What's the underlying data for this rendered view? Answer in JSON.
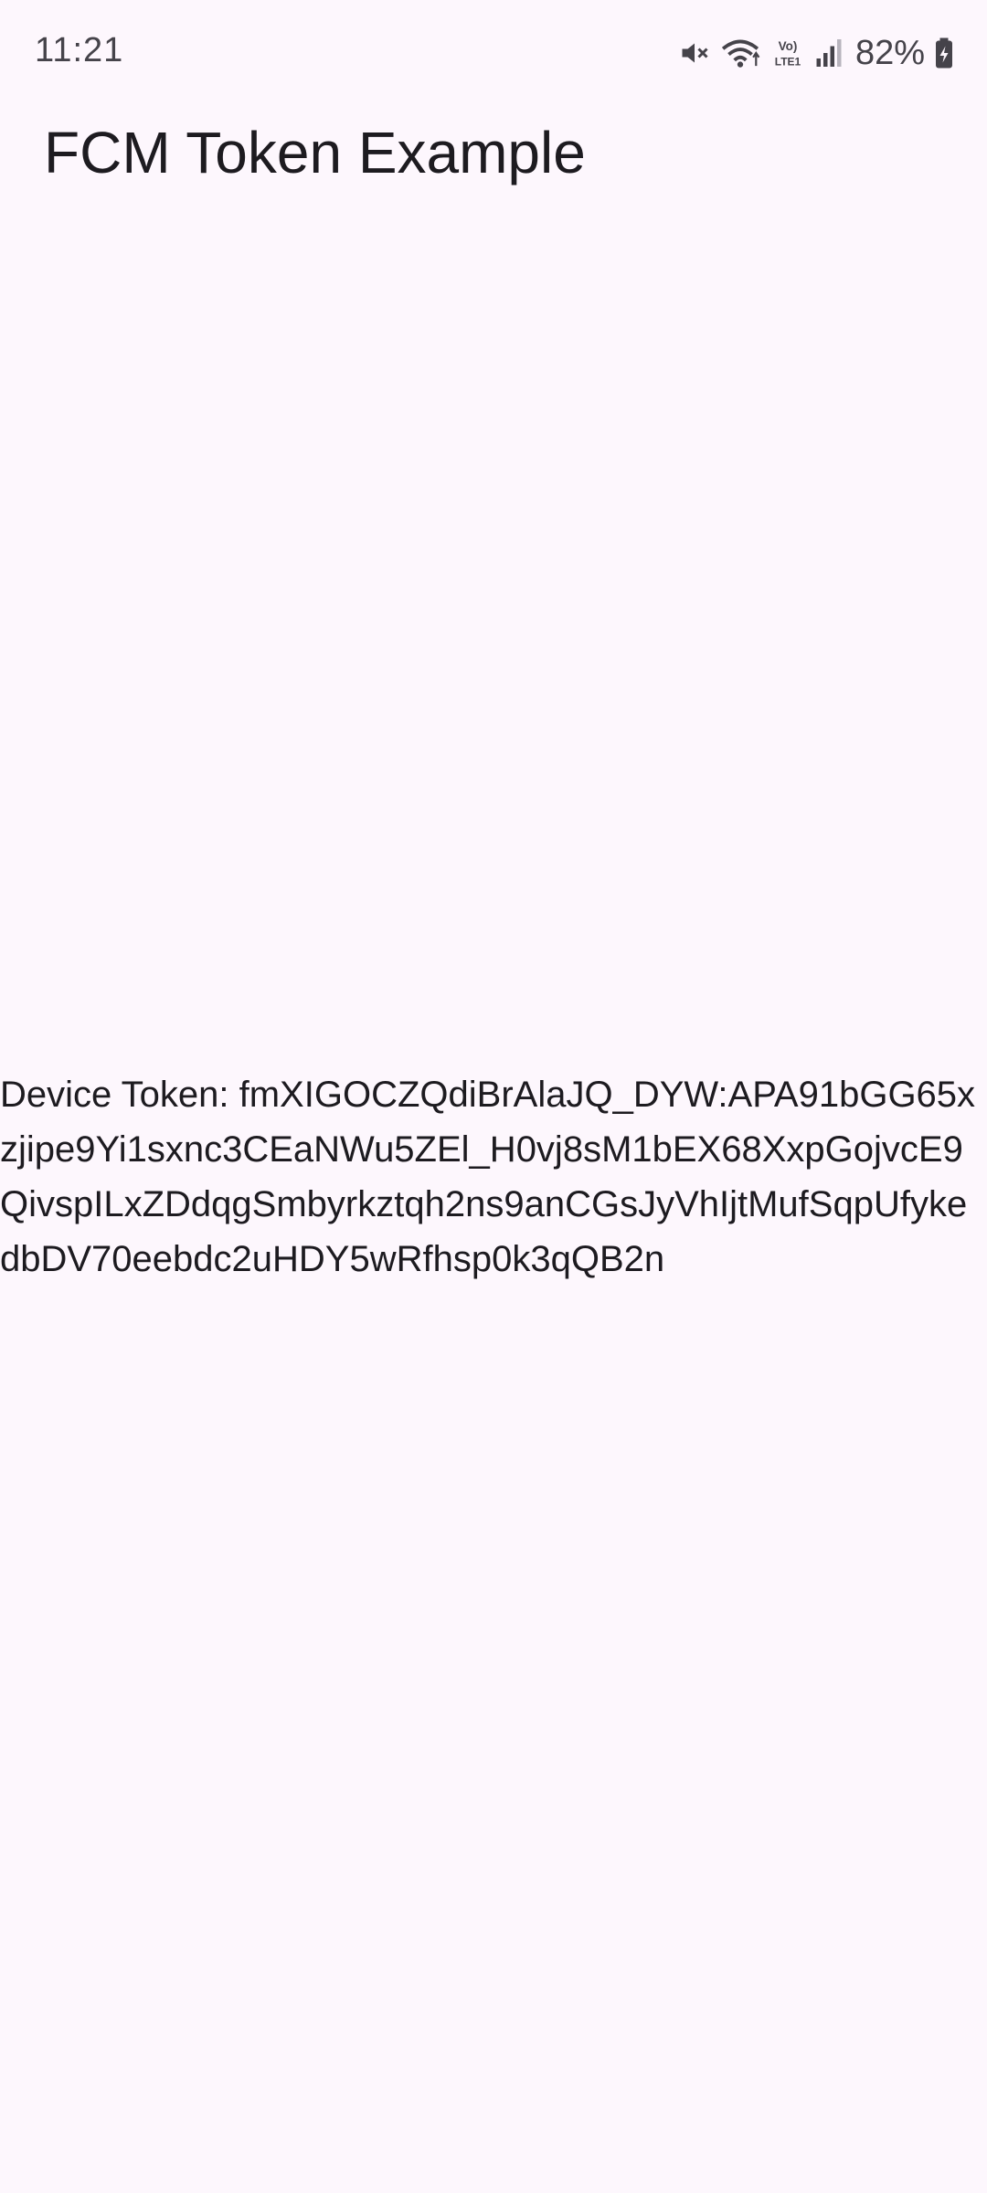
{
  "status_bar": {
    "time": "11:21",
    "battery_percent": "82%",
    "icons": [
      "mute-icon",
      "wifi-icon",
      "volte-icon",
      "signal-icon",
      "battery-icon"
    ],
    "network_label": "VoLTE1"
  },
  "app_bar": {
    "title": "FCM Token Example"
  },
  "main": {
    "token_text": "Device Token: fmXIGOCZQdiBrAlaJQ_DYW:APA91bGG65xzjipe9Yi1sxnc3CEaNWu5ZEl_H0vj8sM1bEX68XxpGojvcE9QivspILxZDdqgSmbyrkztqh2ns9anCGsJyVhIjtMufSqpUfykedbDV70eebdc2uHDY5wRfhsp0k3qQB2n"
  },
  "colors": {
    "background": "#fdf7fd",
    "text_primary": "#1d1b20",
    "status_text": "#45434a"
  }
}
